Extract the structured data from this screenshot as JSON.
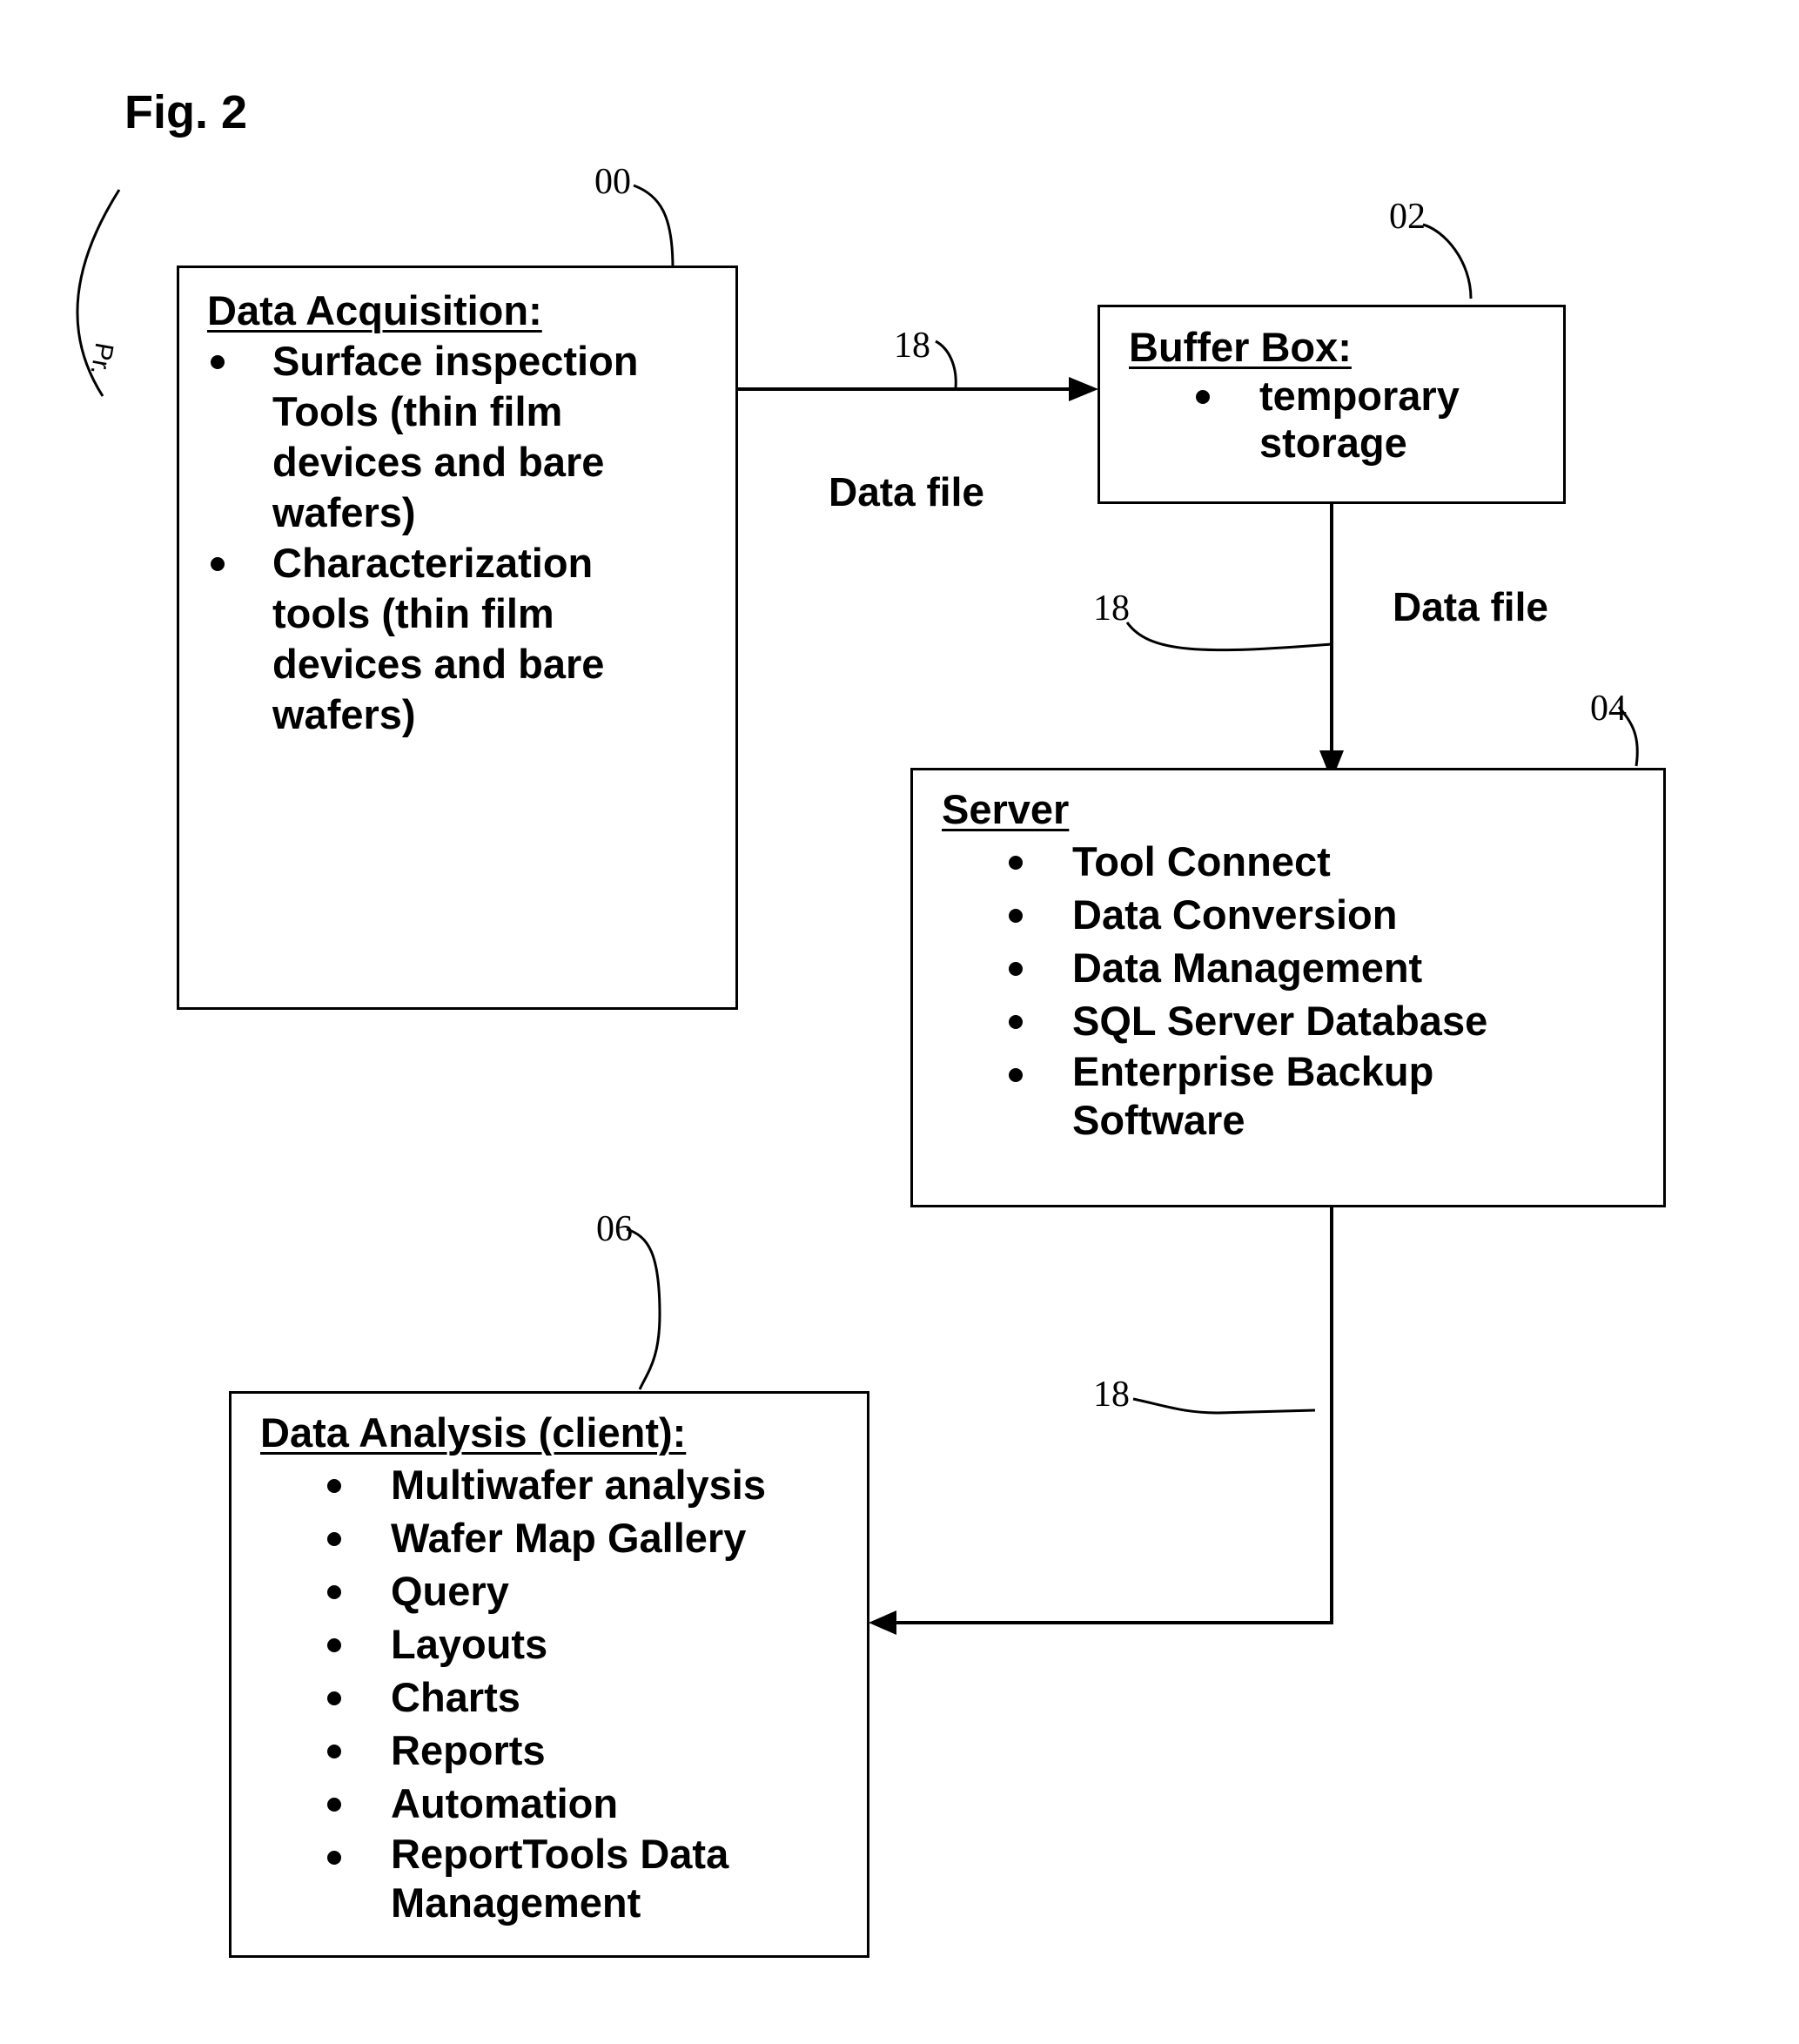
{
  "figure": {
    "title": "Fig. 2",
    "margin_note": "Pr."
  },
  "boxes": {
    "data_acquisition": {
      "ref": "00",
      "title": "Data Acquisition:",
      "items": [
        "Surface inspection Tools (thin film devices and bare wafers)",
        "Characterization tools (thin film devices and bare wafers)"
      ]
    },
    "buffer_box": {
      "ref": "02",
      "title": "Buffer Box:",
      "items": [
        "temporary storage"
      ]
    },
    "server": {
      "ref": "04",
      "title": "Server",
      "items": [
        "Tool Connect",
        "Data Conversion",
        "Data Management",
        "SQL Server Database",
        "Enterprise Backup Software"
      ]
    },
    "data_analysis": {
      "ref": "06",
      "title": "Data Analysis (client):",
      "items": [
        "Multiwafer analysis",
        "Wafer Map Gallery",
        "Query",
        "Layouts",
        "Charts",
        "Reports",
        "Automation",
        "ReportTools Data Management"
      ]
    }
  },
  "connections": [
    {
      "from": "data_acquisition",
      "to": "buffer_box",
      "ref": "18",
      "label": "Data file"
    },
    {
      "from": "buffer_box",
      "to": "server",
      "ref": "18",
      "label": "Data file"
    },
    {
      "from": "server",
      "to": "data_analysis",
      "ref": "18",
      "label": ""
    }
  ]
}
